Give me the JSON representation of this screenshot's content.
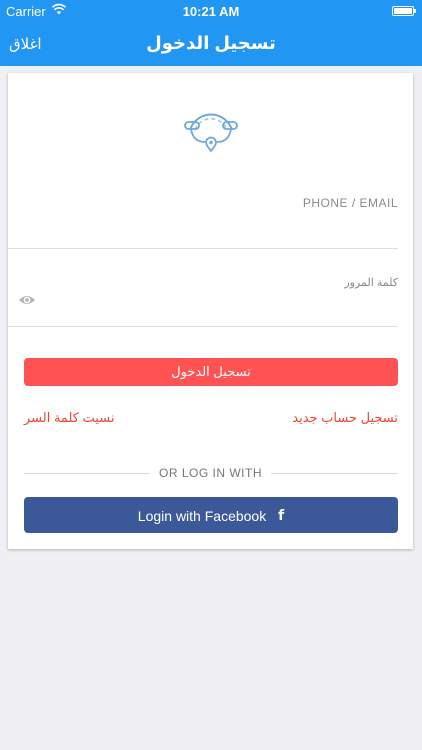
{
  "status_bar": {
    "carrier": "Carrier",
    "time": "10:21 AM",
    "wifi_icon": "wifi-icon",
    "battery_icon": "battery-icon",
    "battery_level": 1.0
  },
  "nav": {
    "close_label": "اغلاق",
    "title": "تسجيل الدخول"
  },
  "logo_icon": "location-logo-icon",
  "form": {
    "phone_label": "PHONE / EMAIL",
    "phone_value": "",
    "password_label": "كلمة المرور",
    "password_value": "",
    "eye_icon": "eye-icon",
    "login_button": "تسجيل الدخول",
    "register_link": "تسجيل حساب جديد",
    "forgot_link": "نسيت كلمة السر",
    "or_text": "OR LOG IN WITH",
    "facebook_button": "Login with Facebook",
    "facebook_icon": "facebook-icon"
  },
  "colors": {
    "primary": "#2196f3",
    "login_button": "#ff5252",
    "link": "#f44336",
    "facebook": "#3b5998",
    "background": "#efeff4"
  }
}
